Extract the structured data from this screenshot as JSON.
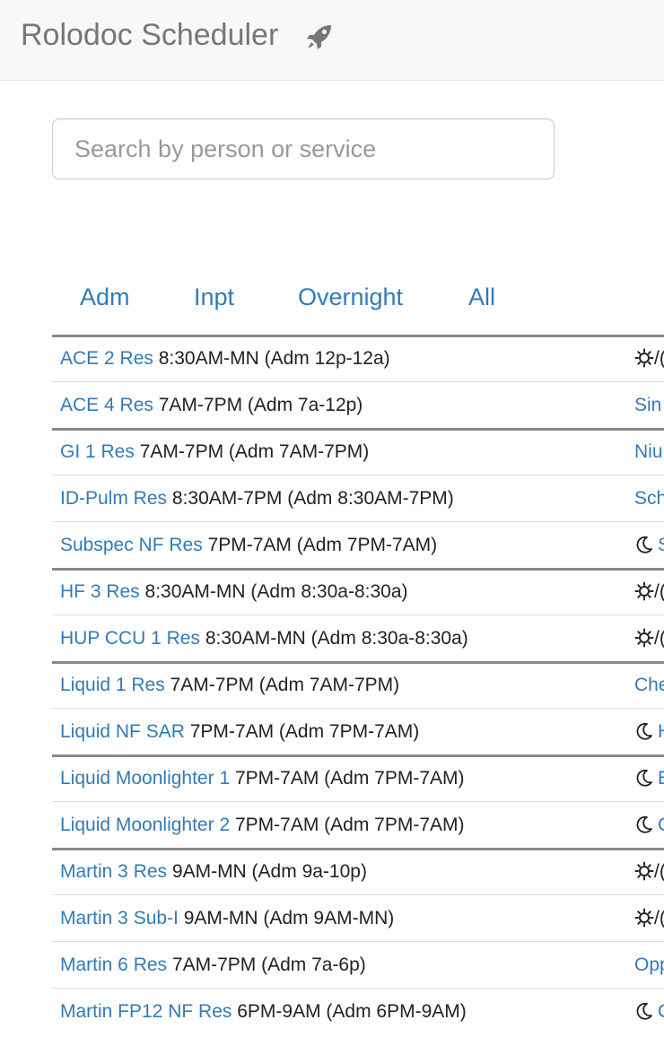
{
  "header": {
    "brand": "Rolodoc Scheduler",
    "brand_icon": "rocket-icon"
  },
  "search": {
    "placeholder": "Search by person or service",
    "value": ""
  },
  "tabs": [
    {
      "label": "Adm"
    },
    {
      "label": "Inpt"
    },
    {
      "label": "Overnight"
    },
    {
      "label": "All"
    }
  ],
  "rows": [
    {
      "service": "ACE 2 Res",
      "hours": "8:30AM-MN (Adm 12p-12a)",
      "right_icon": "sun-icon",
      "right_text": "/("
    },
    {
      "service": "ACE 4 Res",
      "hours": "7AM-7PM (Adm 7a-12p)",
      "right_icon": "",
      "right_text": "Sin"
    },
    {
      "service": "GI 1 Res",
      "hours": "7AM-7PM (Adm 7AM-7PM)",
      "right_icon": "",
      "right_text": "Niu"
    },
    {
      "service": "ID-Pulm Res",
      "hours": "8:30AM-7PM (Adm 8:30AM-7PM)",
      "right_icon": "",
      "right_text": "Sch"
    },
    {
      "service": "Subspec NF Res",
      "hours": "7PM-7AM (Adm 7PM-7AM)",
      "right_icon": "moon-icon",
      "right_text": "S"
    },
    {
      "service": "HF 3 Res",
      "hours": "8:30AM-MN (Adm 8:30a-8:30a)",
      "right_icon": "sun-icon",
      "right_text": "/("
    },
    {
      "service": "HUP CCU 1 Res",
      "hours": "8:30AM-MN (Adm 8:30a-8:30a)",
      "right_icon": "sun-icon",
      "right_text": "/("
    },
    {
      "service": "Liquid 1 Res",
      "hours": "7AM-7PM (Adm 7AM-7PM)",
      "right_icon": "",
      "right_text": "Che"
    },
    {
      "service": "Liquid NF SAR",
      "hours": "7PM-7AM (Adm 7PM-7AM)",
      "right_icon": "moon-icon",
      "right_text": "H"
    },
    {
      "service": "Liquid Moonlighter 1",
      "hours": "7PM-7AM (Adm 7PM-7AM)",
      "right_icon": "moon-icon",
      "right_text": "E"
    },
    {
      "service": "Liquid Moonlighter 2",
      "hours": "7PM-7AM (Adm 7PM-7AM)",
      "right_icon": "moon-icon",
      "right_text": "C"
    },
    {
      "service": "Martin 3 Res",
      "hours": "9AM-MN (Adm 9a-10p)",
      "right_icon": "sun-icon",
      "right_text": "/("
    },
    {
      "service": "Martin 3 Sub-I",
      "hours": "9AM-MN (Adm 9AM-MN)",
      "right_icon": "sun-icon",
      "right_text": "/("
    },
    {
      "service": "Martin 6 Res",
      "hours": "7AM-7PM (Adm 7a-6p)",
      "right_icon": "",
      "right_text": "Opp"
    },
    {
      "service": "Martin FP12 NF Res",
      "hours": "6PM-9AM (Adm 6PM-9AM)",
      "right_icon": "moon-icon",
      "right_text": "C"
    }
  ],
  "colors": {
    "link": "#337ab7",
    "navbar_bg": "#f8f8f8",
    "brand": "#777777",
    "group_border": "#888888",
    "row_border": "#dddddd"
  }
}
